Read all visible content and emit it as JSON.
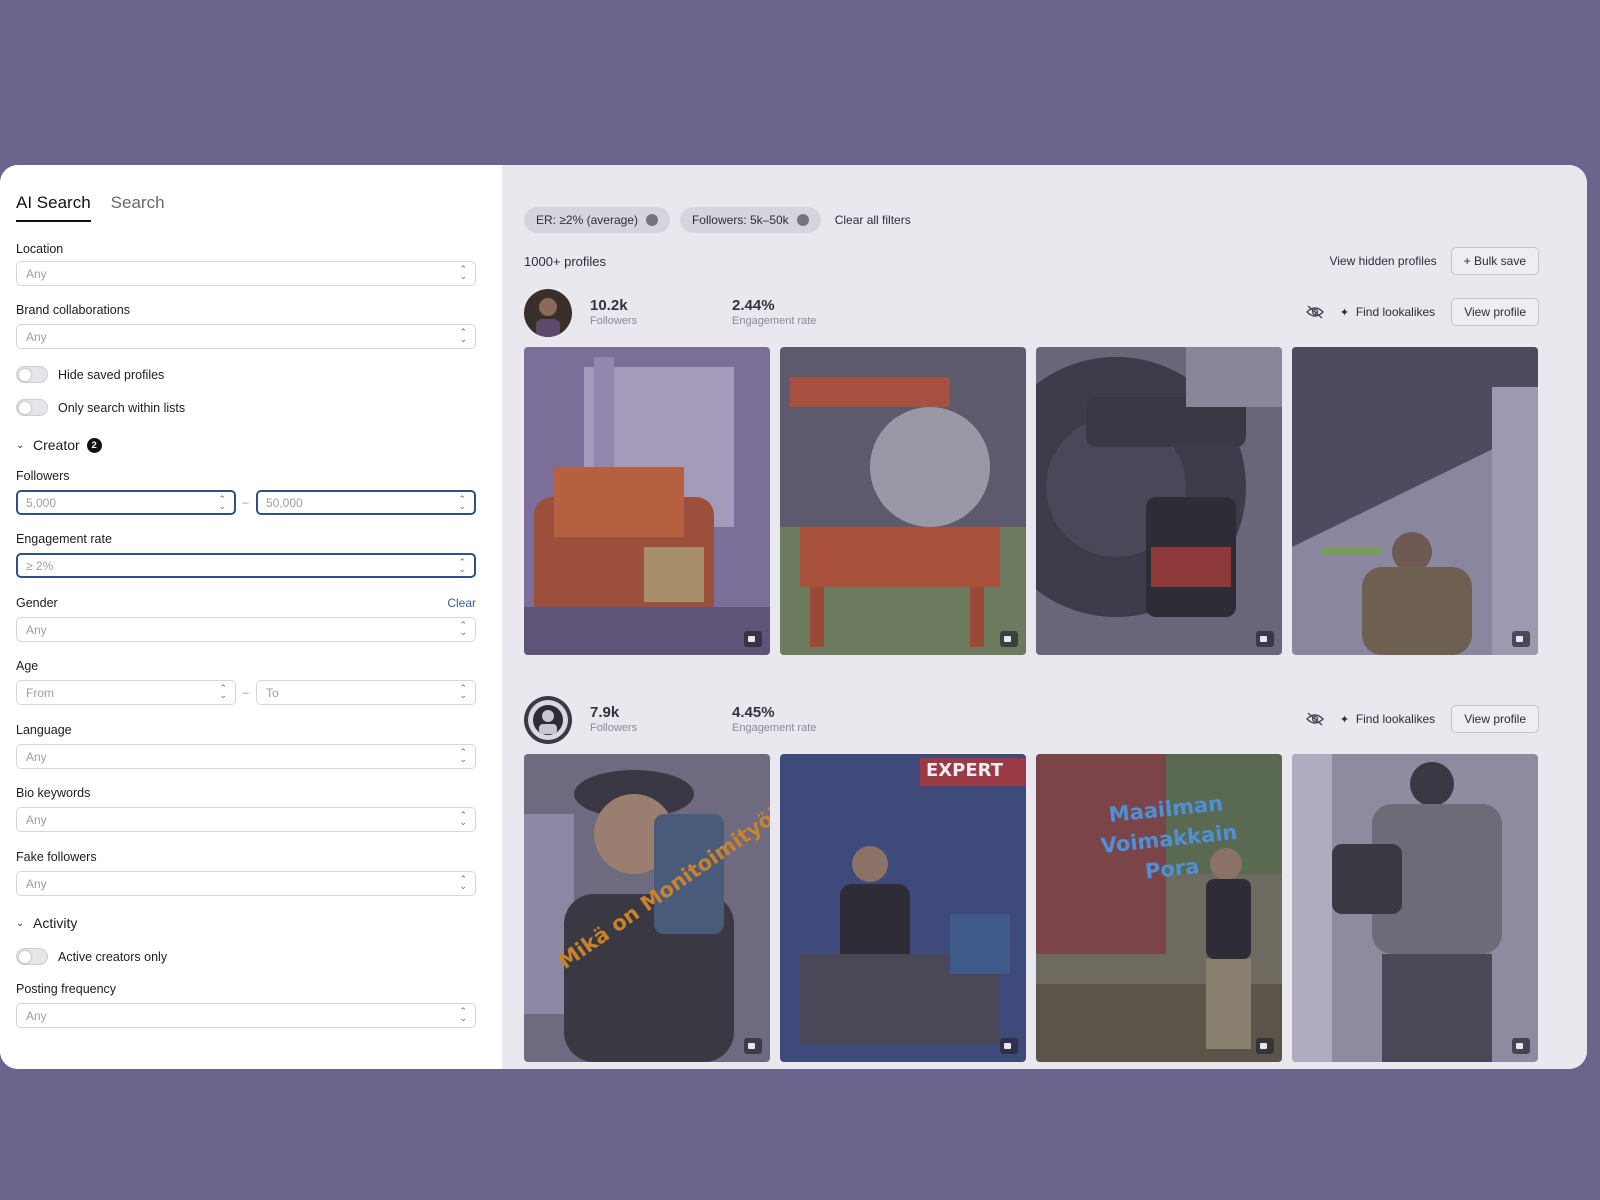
{
  "sidebar": {
    "tabs": [
      {
        "label": "AI Search"
      },
      {
        "label": "Search"
      }
    ],
    "location": {
      "label": "Location",
      "value": "Any"
    },
    "brand": {
      "label": "Brand collaborations",
      "value": "Any"
    },
    "hide_saved": {
      "label": "Hide saved profiles"
    },
    "only_lists": {
      "label": "Only search within lists"
    },
    "creator": {
      "label": "Creator",
      "count": "2"
    },
    "followers": {
      "label": "Followers",
      "min": "5,000",
      "max": "50,000",
      "dash": "–"
    },
    "engagement": {
      "label": "Engagement rate",
      "value": "≥ 2%"
    },
    "gender": {
      "label": "Gender",
      "value": "Any",
      "clear": "Clear"
    },
    "age": {
      "label": "Age",
      "from": "From",
      "to": "To",
      "dash": "–"
    },
    "language": {
      "label": "Language",
      "value": "Any"
    },
    "bio": {
      "label": "Bio keywords",
      "value": "Any"
    },
    "fake": {
      "label": "Fake followers",
      "value": "Any"
    },
    "activity": {
      "label": "Activity"
    },
    "active_only": {
      "label": "Active creators only"
    },
    "posting": {
      "label": "Posting frequency",
      "value": "Any"
    }
  },
  "filters": {
    "chips": [
      {
        "label": "ER: ≥2% (average)"
      },
      {
        "label": "Followers: 5k–50k"
      }
    ],
    "clear_all": "Clear all filters"
  },
  "results": {
    "count": "1000+ profiles",
    "view_hidden": "View hidden profiles",
    "bulk_save": "+ Bulk save",
    "profiles": [
      {
        "followers": "10.2k",
        "followers_label": "Followers",
        "er": "2.44%",
        "er_label": "Engagement rate",
        "lookalikes": "Find lookalikes",
        "view": "View profile"
      },
      {
        "followers": "7.9k",
        "followers_label": "Followers",
        "er": "4.45%",
        "er_label": "Engagement rate",
        "lookalikes": "Find lookalikes",
        "view": "View profile",
        "post_texts": {
          "p1": "Mikä on Monitoimityökalu?",
          "p2": "EXPERT",
          "p3": [
            "Maailman",
            "Voimakkain",
            "Pora"
          ]
        }
      }
    ]
  },
  "icons": {
    "chevron": "chevron-updown-icon",
    "hide": "eye-off-icon",
    "sparkle": "sparkle-icon",
    "video": "video-icon"
  }
}
